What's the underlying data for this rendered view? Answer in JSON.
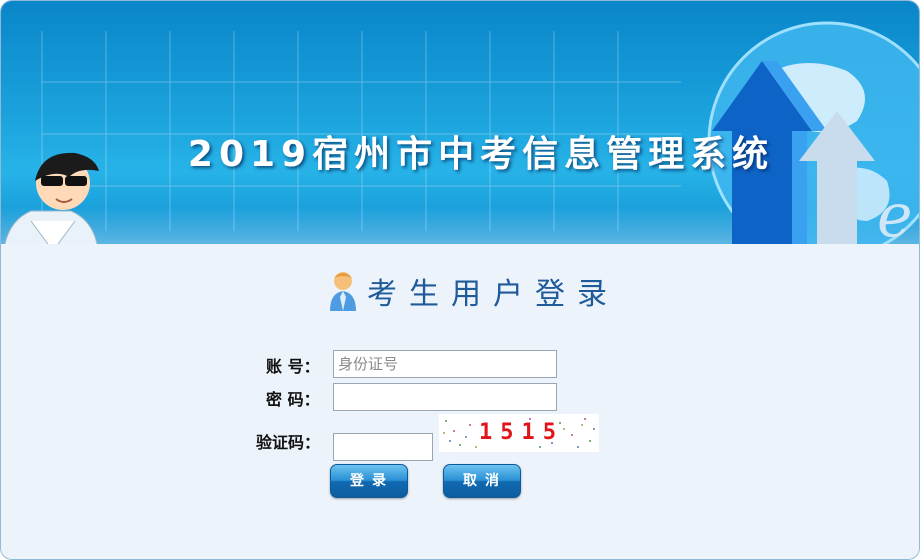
{
  "header": {
    "title": "2019宿州市中考信息管理系统"
  },
  "login": {
    "heading": "考生用户登录",
    "account_label": "账 号：",
    "account_placeholder": "身份证号",
    "account_value": "",
    "password_label": "密 码：",
    "password_value": "",
    "captcha_label": "验证码：",
    "captcha_value": "",
    "captcha_code": "1515",
    "login_button": "登录",
    "cancel_button": "取消"
  },
  "colors": {
    "banner_blue": "#1aa1dc",
    "heading_blue": "#1f5a9a",
    "captcha_red": "#e1141a",
    "button_blue": "#1069b0"
  },
  "icons": [
    "person-cartoon-icon",
    "globe-arrow-graphic",
    "user-icon"
  ]
}
